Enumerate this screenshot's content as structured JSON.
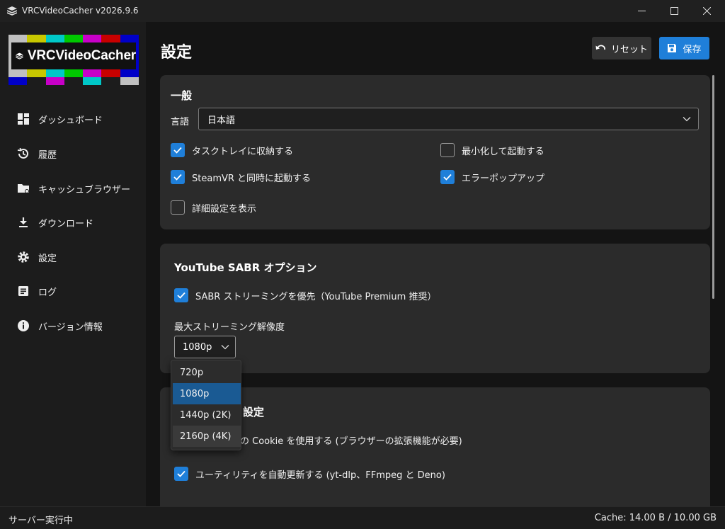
{
  "window": {
    "title": "VRCVideoCacher v2026.9.6",
    "icon": "stack-icon"
  },
  "logo": {
    "text": "VRCVideoCacher",
    "top_colors": [
      "#c0c0c0",
      "#c8c800",
      "#00c8c8",
      "#00c800",
      "#c800c8",
      "#c80000",
      "#0000c8"
    ],
    "bottom_colors": [
      "#0000c8",
      "#1c1c1c",
      "#c800c8",
      "#1c1c1c",
      "#00c8c8",
      "#1c1c1c",
      "#c0c0c0"
    ]
  },
  "sidebar": {
    "items": [
      {
        "label": "ダッシュボード",
        "icon": "dashboard-icon"
      },
      {
        "label": "履歴",
        "icon": "history-icon"
      },
      {
        "label": "キャッシュブラウザー",
        "icon": "folder-icon"
      },
      {
        "label": "ダウンロード",
        "icon": "download-icon"
      },
      {
        "label": "設定",
        "icon": "gear-icon"
      },
      {
        "label": "ログ",
        "icon": "log-icon"
      },
      {
        "label": "バージョン情報",
        "icon": "info-icon"
      }
    ]
  },
  "header": {
    "title": "設定",
    "reset_label": "リセット",
    "save_label": "保存"
  },
  "general": {
    "heading": "一般",
    "language_label": "言語",
    "language_value": "日本語",
    "options": [
      {
        "label": "タスクトレイに収納する",
        "checked": true
      },
      {
        "label": "最小化して起動する",
        "checked": false
      },
      {
        "label": "SteamVR と同時に起動する",
        "checked": true
      },
      {
        "label": "エラーポップアップ",
        "checked": true
      },
      {
        "label": "詳細設定を表示",
        "checked": false
      }
    ]
  },
  "sabr": {
    "heading": "YouTube SABR オプション",
    "prefer_label": "SABR ストリーミングを優先（YouTube Premium 推奨）",
    "prefer_checked": true,
    "resolution_label": "最大ストリーミング解像度",
    "resolution_value": "1080p",
    "resolution_options": [
      "720p",
      "1080p",
      "1440p (2K)",
      "2160p (4K)"
    ]
  },
  "third": {
    "heading_partial": "設定",
    "cookie_label": "の Cookie を使用する (ブラウザーの拡張機能が必要)",
    "autoupdate_label": "ユーティリティを自動更新する (yt-dlp、FFmpeg と Deno)",
    "autoupdate_checked": true
  },
  "status": {
    "left": "サーバー実行中",
    "right": "Cache: 14.00 B / 10.00 GB"
  },
  "colors": {
    "accent": "#1f7fd9",
    "card": "#2b2b2b",
    "background": "#141414"
  }
}
